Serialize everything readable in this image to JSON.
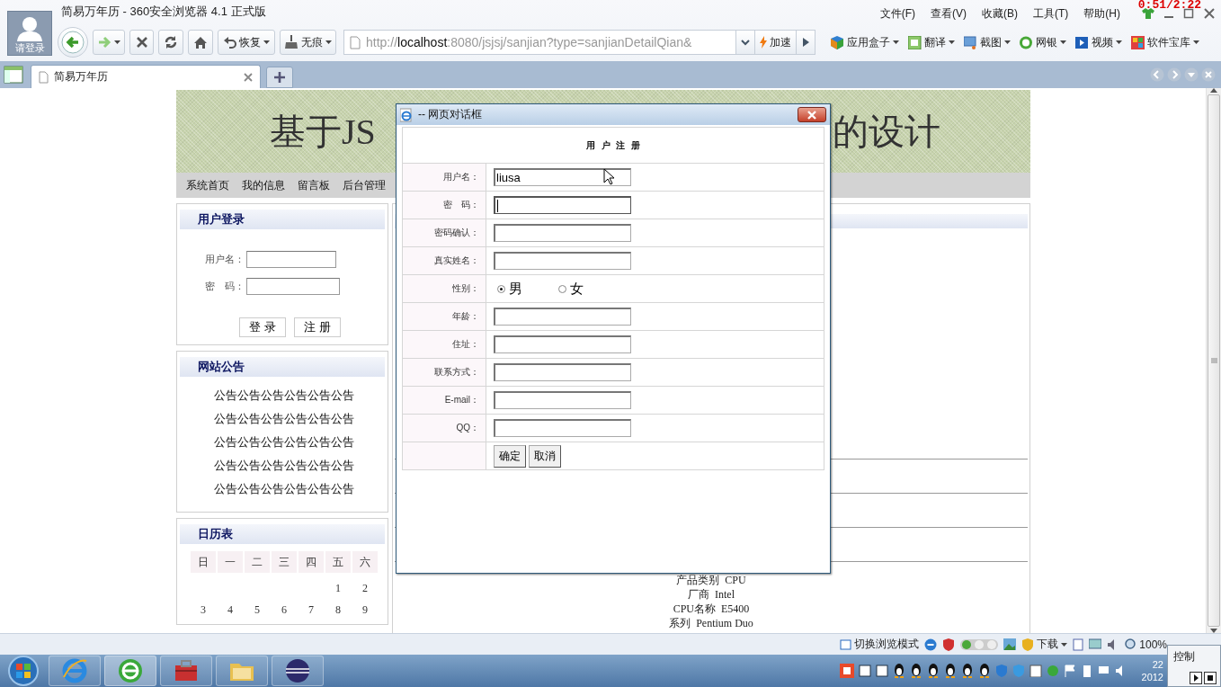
{
  "browser": {
    "account_label": "请登录",
    "title": "简易万年历 - 360安全浏览器 4.1 正式版",
    "menu": [
      "文件(F)",
      "查看(V)",
      "收藏(B)",
      "工具(T)",
      "帮助(H)"
    ],
    "recording_timer": "0:51/2:22",
    "toolbar": {
      "restore": "恢复",
      "incognito": "无痕",
      "accelerate": "加速"
    },
    "url": {
      "scheme": "http://",
      "host": "localhost",
      "rest": ":8080/jsjsj/sanjian?type=sanjianDetailQian&"
    },
    "addons": [
      "应用盒子",
      "翻译",
      "截图",
      "网银",
      "视频",
      "软件宝库"
    ],
    "tabs": [
      {
        "label": "简易万年历",
        "selected": true
      }
    ]
  },
  "page": {
    "banner_left": "基于JS",
    "banner_right": "的设计",
    "nav": [
      "系统首页",
      "我的信息",
      "留言板",
      "后台管理"
    ],
    "login": {
      "title": "用户登录",
      "username_label": "用户名：",
      "password_label": "密　码：",
      "buttons": [
        "登 录",
        "注 册"
      ]
    },
    "notice": {
      "title": "网站公告",
      "items": [
        "公告公告公告公告公告公告",
        "公告公告公告公告公告公告",
        "公告公告公告公告公告公告",
        "公告公告公告公告公告公告",
        "公告公告公告公告公告公告"
      ]
    },
    "calendar": {
      "title": "日历表",
      "weekdays": [
        "日",
        "一",
        "二",
        "三",
        "四",
        "五",
        "六"
      ],
      "weeks": [
        {
          "kind": "end",
          "days": [
            "1",
            "2"
          ]
        },
        {
          "kind": "full",
          "days": [
            "3",
            "4",
            "5",
            "6",
            "7",
            "8",
            "9"
          ]
        }
      ]
    },
    "product_lines": [
      "产品类别  CPU",
      "厂商  Intel",
      "CPU名称  E5400",
      "系列  Pentium Duo"
    ]
  },
  "dialog": {
    "title": "-- 网页对话框",
    "heading": "用 户 注 册",
    "fields": [
      {
        "kind": "text",
        "label": "用户名：",
        "value": "liusa",
        "focused": false
      },
      {
        "kind": "text",
        "label": "密　码：",
        "focused": true
      },
      {
        "kind": "text",
        "label": "密码确认：",
        "focused": false
      },
      {
        "kind": "text",
        "label": "真实姓名：",
        "focused": false
      },
      {
        "kind": "radio",
        "label": "性别：",
        "options": [
          {
            "label": "男",
            "selected": true
          },
          {
            "label": "女",
            "selected": false
          }
        ]
      },
      {
        "kind": "text",
        "label": "年龄：",
        "focused": false
      },
      {
        "kind": "text",
        "label": "住址：",
        "focused": false
      },
      {
        "kind": "text",
        "label": "联系方式：",
        "focused": false
      },
      {
        "kind": "text",
        "label": "E-mail：",
        "focused": false
      },
      {
        "kind": "text",
        "label": "QQ：",
        "focused": false
      }
    ],
    "buttons": [
      "确定",
      "取消"
    ]
  },
  "status_bar": {
    "mode_switch": "切换浏览模式",
    "download": "下载",
    "zoom": "100%"
  },
  "control_popup": {
    "title": "控制"
  },
  "taskbar": {
    "clock_time": "22",
    "clock_date": "2012"
  }
}
